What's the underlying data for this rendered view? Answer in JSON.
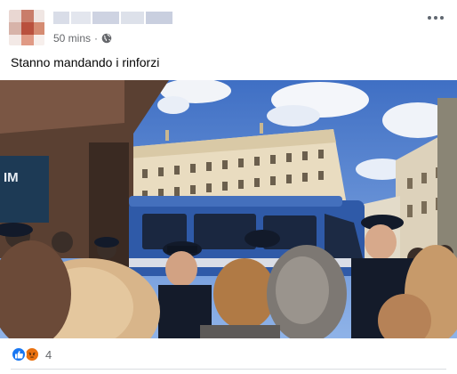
{
  "post": {
    "time": "50 mins",
    "separator": "·",
    "audience_icon": "globe-icon",
    "more_icon": "more-options-icon",
    "caption": "Stanno mandando i rinforzi",
    "photo_icon": "photo-crowd-police-van",
    "reactions": {
      "types": [
        "like-icon",
        "angry-icon"
      ],
      "count": "4"
    }
  },
  "colors": {
    "like": "#1877f2",
    "angry": "#e9710f",
    "meta_text": "#65676b"
  }
}
